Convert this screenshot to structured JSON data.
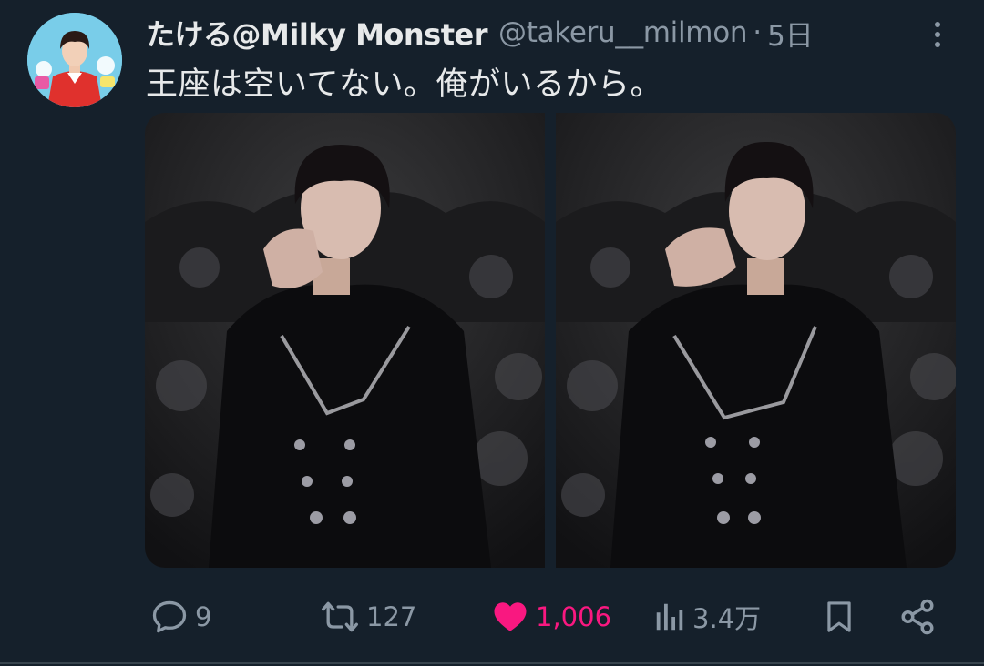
{
  "tweet": {
    "display_name": "たける@Milky Monster",
    "handle": "@takeru__milmon",
    "separator": "·",
    "time": "5日",
    "text": "王座は空いてない。俺がいるから。"
  },
  "avatar": {
    "icon": "avatar-photo"
  },
  "media": {
    "count": 2,
    "icons": [
      "photo-1",
      "photo-2"
    ]
  },
  "actions": {
    "reply": {
      "icon": "reply-icon",
      "count": "9"
    },
    "retweet": {
      "icon": "retweet-icon",
      "count": "127"
    },
    "like": {
      "icon": "heart-icon",
      "count": "1,006",
      "liked": true,
      "color": "#f91880"
    },
    "views": {
      "icon": "views-icon",
      "count": "3.4万"
    },
    "bookmark": {
      "icon": "bookmark-icon"
    },
    "share": {
      "icon": "share-icon"
    }
  },
  "colors": {
    "background": "#15202b",
    "text": "#e7e9ea",
    "muted": "#8b98a5",
    "like": "#f91880"
  }
}
